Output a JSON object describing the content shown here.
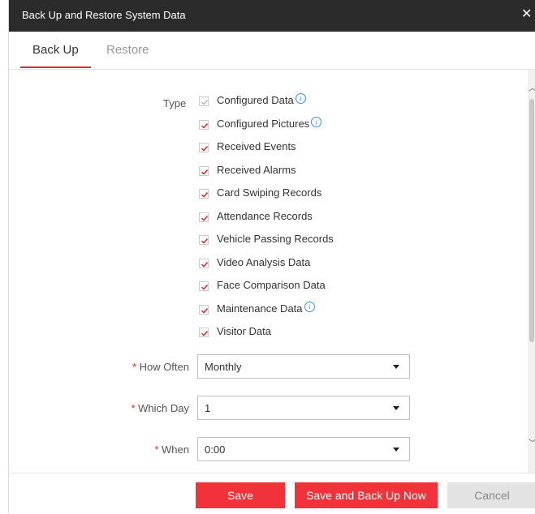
{
  "dialog": {
    "title": "Back Up and Restore System Data",
    "close_glyph": "✕"
  },
  "tabs": [
    {
      "label": "Back Up",
      "active": true
    },
    {
      "label": "Restore",
      "active": false
    }
  ],
  "form": {
    "type_label": "Type",
    "checkboxes": [
      {
        "label": "Configured Data",
        "checked": true,
        "disabled": true,
        "info": true
      },
      {
        "label": "Configured Pictures",
        "checked": true,
        "disabled": false,
        "info": true
      },
      {
        "label": "Received Events",
        "checked": true,
        "disabled": false,
        "info": false
      },
      {
        "label": "Received Alarms",
        "checked": true,
        "disabled": false,
        "info": false
      },
      {
        "label": "Card Swiping Records",
        "checked": true,
        "disabled": false,
        "info": false
      },
      {
        "label": "Attendance Records",
        "checked": true,
        "disabled": false,
        "info": false
      },
      {
        "label": "Vehicle Passing Records",
        "checked": true,
        "disabled": false,
        "info": false
      },
      {
        "label": "Video Analysis Data",
        "checked": true,
        "disabled": false,
        "info": false
      },
      {
        "label": "Face Comparison Data",
        "checked": true,
        "disabled": false,
        "info": false
      },
      {
        "label": "Maintenance Data",
        "checked": true,
        "disabled": false,
        "info": true
      },
      {
        "label": "Visitor Data",
        "checked": true,
        "disabled": false,
        "info": false
      }
    ],
    "how_often": {
      "required_mark": "*",
      "label": "How Often",
      "value": "Monthly"
    },
    "which_day": {
      "required_mark": "*",
      "label": "Which Day",
      "value": "1"
    },
    "when": {
      "required_mark": "*",
      "label": "When",
      "value": "0:00"
    }
  },
  "footer": {
    "save": "Save",
    "save_backup_now": "Save and Back Up Now",
    "cancel": "Cancel"
  },
  "colors": {
    "accent": "#f2323b",
    "titlebar": "#2b2b2b",
    "check": "#e32b2b",
    "check_disabled": "#bbbbbb",
    "info": "#3b8fe0"
  }
}
